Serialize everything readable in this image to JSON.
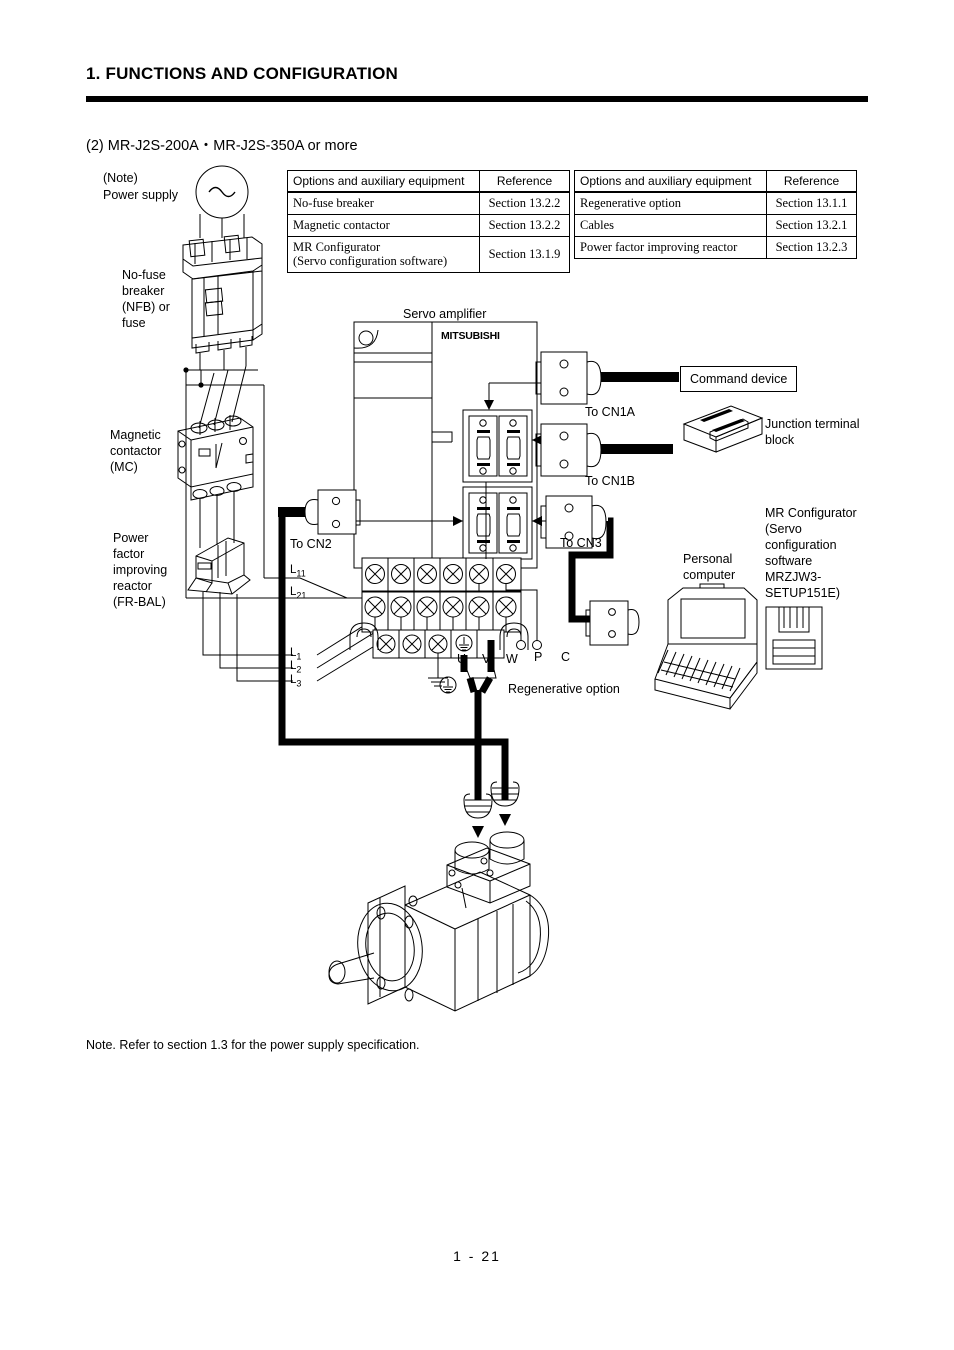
{
  "header": {
    "chapter_title": "1. FUNCTIONS AND CONFIGURATION",
    "section_label": "(2) MR-J2S-200A・MR-J2S-350A or more"
  },
  "tables": {
    "left": {
      "columns": [
        "Options and auxiliary equipment",
        "Reference"
      ],
      "rows": [
        {
          "item": "No-fuse breaker",
          "reference": "Section 13.2.2"
        },
        {
          "item": "Magnetic contactor",
          "reference": "Section 13.2.2"
        },
        {
          "item": "MR Configurator\n(Servo configuration software)",
          "reference": "Section 13.1.9"
        }
      ]
    },
    "right": {
      "columns": [
        "Options and auxiliary equipment",
        "Reference"
      ],
      "rows": [
        {
          "item": "Regenerative option",
          "reference": "Section 13.1.1"
        },
        {
          "item": "Cables",
          "reference": "Section 13.2.1"
        },
        {
          "item": "Power factor improving reactor",
          "reference": "Section 13.2.3"
        }
      ]
    }
  },
  "diagram": {
    "power_supply_note": "(Note)",
    "power_supply": "Power supply",
    "nfb": "No-fuse\nbreaker\n(NFB) or\nfuse",
    "magnetic_contactor": "Magnetic\ncontactor\n(MC)",
    "power_factor_reactor": "Power\nfactor\nimproving\nreactor\n(FR-BAL)",
    "servo_amplifier": "Servo amplifier",
    "brand": "MITSUBISHI",
    "to_cn1a": "To CN1A",
    "to_cn1b": "To CN1B",
    "to_cn2": "To CN2",
    "to_cn3": "To CN3",
    "command_device": "Command device",
    "junction_terminal_block": "Junction terminal\nblock",
    "mr_configurator": "MR Configurator\n(Servo\nconfiguration\nsoftware\nMRZJW3-\nSETUP151E)",
    "personal_computer": "Personal\ncomputer",
    "regenerative_option": "Regenerative option",
    "terminals": {
      "l11": "L",
      "l11_sub": "11",
      "l21": "L",
      "l21_sub": "21",
      "l1": "L",
      "l1_sub": "1",
      "l2": "L",
      "l2_sub": "2",
      "l3": "L",
      "l3_sub": "3",
      "u": "U",
      "v": "V",
      "w": "W",
      "p": "P",
      "c": "C"
    }
  },
  "footer": {
    "note": "Note. Refer to section 1.3 for the power supply specification.",
    "page_number": "1 -  21"
  },
  "colors": {
    "ink": "#000000",
    "paper": "#ffffff"
  }
}
